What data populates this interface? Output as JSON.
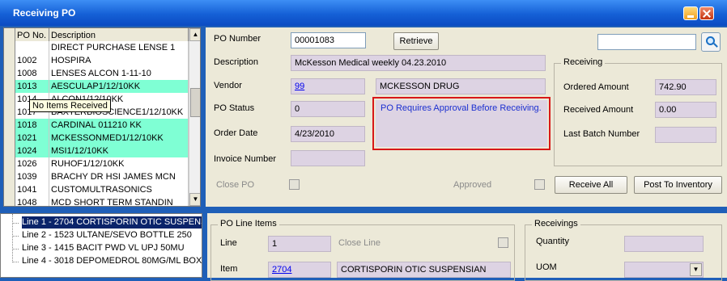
{
  "window": {
    "title": "Receiving PO"
  },
  "grid": {
    "headers": {
      "po": "PO No.",
      "desc": "Description"
    },
    "rows": [
      {
        "po": "",
        "desc": "DIRECT PURCHASE LENSE 1",
        "highlight": false
      },
      {
        "po": "1002",
        "desc": "HOSPIRA",
        "highlight": false
      },
      {
        "po": "1008",
        "desc": "LENSES ALCON 1-11-10",
        "highlight": false
      },
      {
        "po": "1013",
        "desc": "AESCULAP1/12/10KK",
        "highlight": true
      },
      {
        "po": "1014",
        "desc": "ALCON1/12/10KK",
        "highlight": false
      },
      {
        "po": "1017",
        "desc": "BAXTERBIOSCIENCE1/12/10KK",
        "highlight": false
      },
      {
        "po": "1018",
        "desc": "CARDINAL 011210 KK",
        "highlight": true
      },
      {
        "po": "1021",
        "desc": "MCKESSONMED1/12/10KK",
        "highlight": true
      },
      {
        "po": "1024",
        "desc": "MSI1/12/10KK",
        "highlight": true
      },
      {
        "po": "1026",
        "desc": "RUHOF1/12/10KK",
        "highlight": false
      },
      {
        "po": "1039",
        "desc": "BRACHY DR HSI JAMES MCN",
        "highlight": false
      },
      {
        "po": "1041",
        "desc": "CUSTOMULTRASONICS",
        "highlight": false
      },
      {
        "po": "1048",
        "desc": "MCD SHORT TERM STANDIN",
        "highlight": false
      }
    ],
    "tooltip": "No Items Received"
  },
  "form": {
    "po_number_label": "PO Number",
    "po_number": "00001083",
    "retrieve_label": "Retrieve",
    "search_value": "",
    "description_label": "Description",
    "description": "McKesson Medical weekly 04.23.2010",
    "vendor_label": "Vendor",
    "vendor_id": "99",
    "vendor_name": "MCKESSON DRUG",
    "status_label": "PO Status",
    "status": "0",
    "approval_message": "PO Requires Approval Before Receiving.",
    "order_date_label": "Order Date",
    "order_date": "4/23/2010",
    "invoice_label": "Invoice Number",
    "invoice": "",
    "close_po_label": "Close PO",
    "approved_label": "Approved",
    "receive_all_label": "Receive All",
    "post_label": "Post To Inventory"
  },
  "receiving": {
    "title": "Receiving",
    "ordered_label": "Ordered Amount",
    "ordered": "742.90",
    "received_label": "Received Amount",
    "received": "0.00",
    "batch_label": "Last Batch Number",
    "batch": ""
  },
  "tree": {
    "items": [
      "Line 1 - 2704 CORTISPORIN OTIC SUSPENS",
      "Line 2 - 1523 ULTANE/SEVO BOTTLE       250",
      "Line 3 - 1415 BACIT PWD VL        UPJ  50MU",
      "Line 4 - 3018 DEPOMEDROL 80MG/ML BOX"
    ]
  },
  "line_items": {
    "title": "PO Line Items",
    "line_label": "Line",
    "line": "1",
    "close_line_label": "Close Line",
    "item_label": "Item",
    "item_id": "2704",
    "item_desc": "CORTISPORIN OTIC SUSPENSIAN"
  },
  "receivings": {
    "title": "Receivings",
    "quantity_label": "Quantity",
    "quantity": "",
    "uom_label": "UOM",
    "uom": ""
  },
  "colors": {
    "highlight_row": "#7fffd4",
    "title_bar": "#1560d6",
    "field_bg": "#ddd3e3",
    "alert_border": "#d81818",
    "link": "#0000ee"
  }
}
